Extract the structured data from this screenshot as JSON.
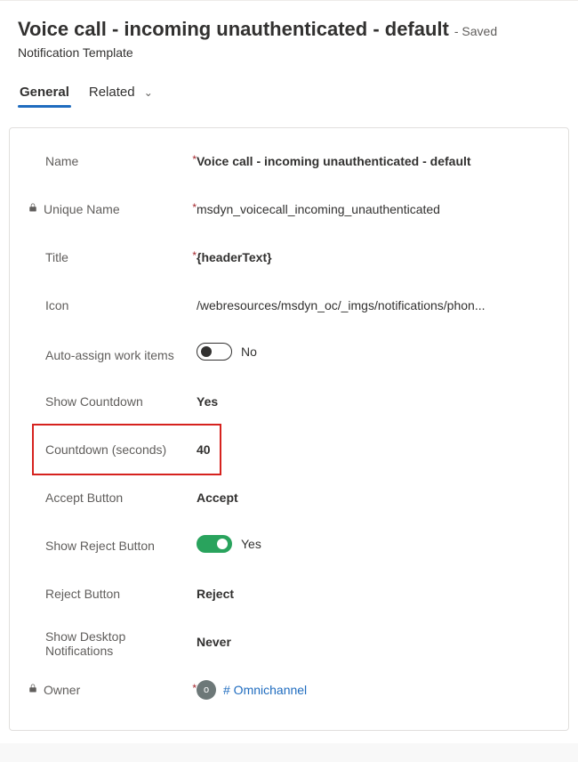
{
  "header": {
    "title": "Voice call - incoming unauthenticated - default",
    "save_status": "- Saved",
    "subtitle": "Notification Template"
  },
  "tabs": {
    "general": "General",
    "related": "Related"
  },
  "labels": {
    "name": "Name",
    "unique_name": "Unique Name",
    "title": "Title",
    "icon": "Icon",
    "auto_assign": "Auto-assign work items",
    "show_countdown": "Show Countdown",
    "countdown": "Countdown (seconds)",
    "accept_button": "Accept Button",
    "show_reject": "Show Reject Button",
    "reject_button": "Reject Button",
    "show_desktop": "Show Desktop Notifications",
    "owner": "Owner"
  },
  "values": {
    "name": "Voice call - incoming unauthenticated - default",
    "unique_name": "msdyn_voicecall_incoming_unauthenticated",
    "title": "{headerText}",
    "icon": "/webresources/msdyn_oc/_imgs/notifications/phon...",
    "auto_assign_state": "No",
    "show_countdown": "Yes",
    "countdown": "40",
    "accept_button": "Accept",
    "show_reject_state": "Yes",
    "reject_button": "Reject",
    "show_desktop": "Never",
    "owner_initial": "o",
    "owner_text": "# Omnichannel"
  },
  "required_marker": "*"
}
